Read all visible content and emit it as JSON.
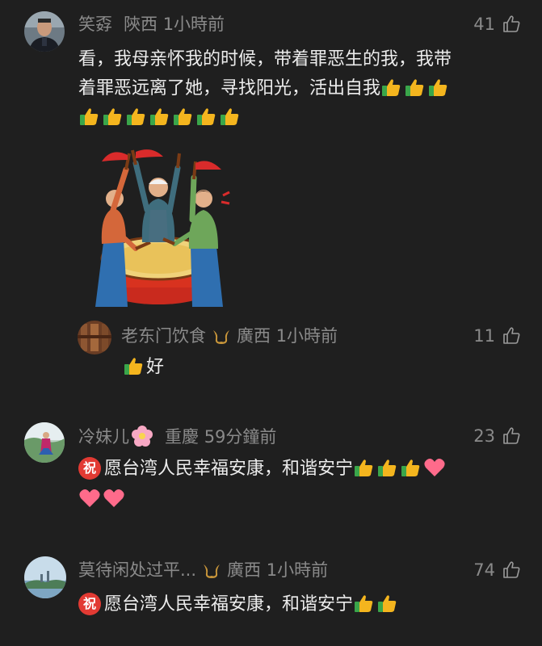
{
  "comments": [
    {
      "username": "笑孬",
      "location": "陝西",
      "time": "1小時前",
      "likes": "41",
      "text_line1": "看，我母亲怀我的时候，带着罪恶生的我，我带",
      "text_line2": "着罪恶远离了她，寻找阳光，活出自我",
      "avatar_icon": "officer-avatar-icon",
      "sticker_icon": "drum-celebration-sticker"
    },
    {
      "username": "老东门饮食",
      "location": "廣西",
      "time": "1小時前",
      "likes": "11",
      "text": "好",
      "avatar_icon": "wood-interior-avatar-icon"
    },
    {
      "username": "冷妹儿",
      "location": "重慶",
      "time": "59分鐘前",
      "likes": "23",
      "badge": "祝",
      "text": "愿台湾人民幸福安康，和谐安宁",
      "avatar_icon": "dancer-avatar-icon"
    },
    {
      "username": "莫待闲处过平...",
      "location": "廣西",
      "time": "1小時前",
      "likes": "74",
      "badge": "祝",
      "text": "愿台湾人民幸福安康，和谐安宁",
      "avatar_icon": "landscape-avatar-icon"
    }
  ],
  "colors": {
    "background": "#1f1f1f",
    "meta_text": "#8a8a8a",
    "body_text": "#ececec",
    "badge_red": "#e23a33"
  }
}
